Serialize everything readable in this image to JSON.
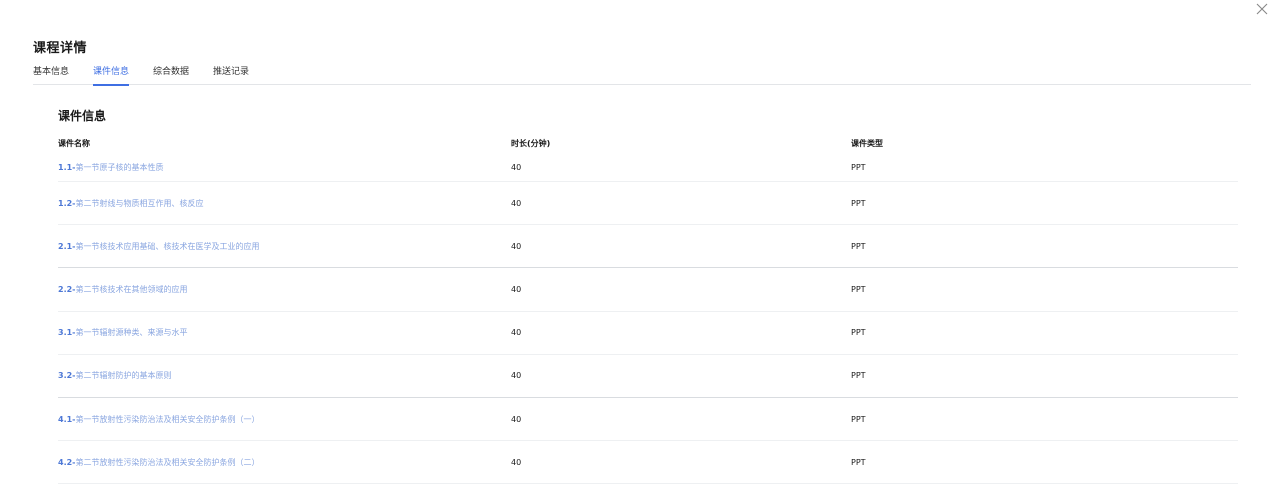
{
  "dialog": {
    "title": "课程详情"
  },
  "tabs": [
    {
      "label": "基本信息",
      "active": false
    },
    {
      "label": "课件信息",
      "active": true
    },
    {
      "label": "综合数据",
      "active": false
    },
    {
      "label": "推送记录",
      "active": false
    }
  ],
  "section": {
    "title": "课件信息"
  },
  "table": {
    "headers": {
      "name": "课件名称",
      "duration": "时长(分钟)",
      "type": "课件类型"
    },
    "rows": [
      {
        "num": "1.1-",
        "title": "第一节原子核的基本性质",
        "duration": "40",
        "type": "PPT"
      },
      {
        "num": "1.2-",
        "title": "第二节射线与物质相互作用、核反应",
        "duration": "40",
        "type": "PPT"
      },
      {
        "num": "2.1-",
        "title": "第一节核技术应用基础、核技术在医学及工业的应用",
        "duration": "40",
        "type": "PPT"
      },
      {
        "num": "2.2-",
        "title": "第二节核技术在其他领域的应用",
        "duration": "40",
        "type": "PPT"
      },
      {
        "num": "3.1-",
        "title": "第一节辐射源种类、来源与水平",
        "duration": "40",
        "type": "PPT"
      },
      {
        "num": "3.2-",
        "title": "第二节辐射防护的基本原则",
        "duration": "40",
        "type": "PPT"
      },
      {
        "num": "4.1-",
        "title": "第一节放射性污染防治法及相关安全防护条例（一）",
        "duration": "40",
        "type": "PPT"
      },
      {
        "num": "4.2-",
        "title": "第二节放射性污染防治法及相关安全防护条例（二）",
        "duration": "40",
        "type": "PPT"
      }
    ]
  },
  "colors": {
    "accent": "#3f6fe3",
    "link": "#8aa6e0",
    "link_number": "#4d78d6"
  },
  "icons": {
    "close": "close-icon"
  }
}
